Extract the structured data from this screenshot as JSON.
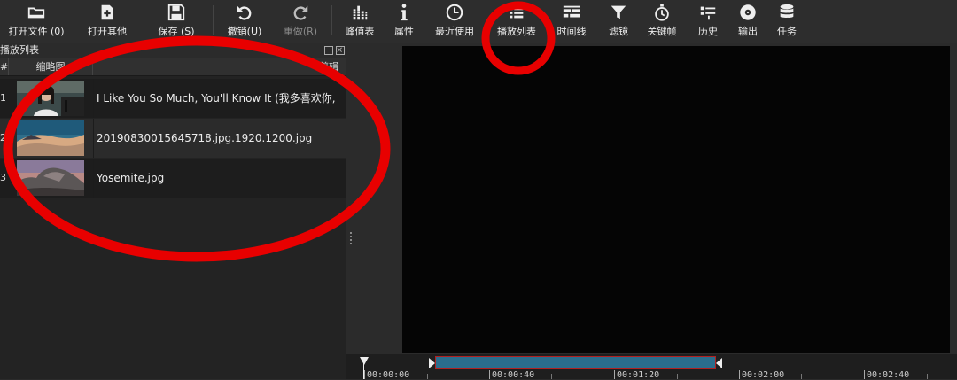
{
  "toolbar": {
    "items": [
      {
        "label": "打开文件 (0)",
        "icon": "folder-open-icon"
      },
      {
        "label": "打开其他",
        "icon": "open-other-icon"
      },
      {
        "label": "保存 (S)",
        "icon": "save-icon"
      },
      {
        "label": "撤销(U)",
        "icon": "undo-icon"
      },
      {
        "label": "重做(R)",
        "icon": "redo-icon",
        "disabled": true
      },
      {
        "label": "峰值表",
        "icon": "peak-meter-icon"
      },
      {
        "label": "属性",
        "icon": "info-icon"
      },
      {
        "label": "最近使用",
        "icon": "clock-icon"
      },
      {
        "label": "播放列表",
        "icon": "playlist-icon"
      },
      {
        "label": "时间线",
        "icon": "timeline-icon"
      },
      {
        "label": "滤镜",
        "icon": "filter-icon"
      },
      {
        "label": "关键帧",
        "icon": "stopwatch-icon"
      },
      {
        "label": "历史",
        "icon": "history-icon"
      },
      {
        "label": "输出",
        "icon": "export-disc-icon"
      },
      {
        "label": "任务",
        "icon": "database-stack-icon"
      }
    ]
  },
  "playlist": {
    "title": "播放列表",
    "headers": {
      "num": "#",
      "thumbnail": "缩略图",
      "clip": "剪辑"
    },
    "rows": [
      {
        "num": "1",
        "name": "I Like You So Much, You'll Know It (我多喜欢你,",
        "thumb": "portrait-thumbnail"
      },
      {
        "num": "2",
        "name": "20190830015645718.jpg.1920.1200.jpg",
        "thumb": "landscape-thumbnail"
      },
      {
        "num": "3",
        "name": "Yosemite.jpg",
        "thumb": "yosemite-thumbnail"
      }
    ]
  },
  "scrubber": {
    "ticks": [
      "00:00:00",
      "00:00:40",
      "00:01:20",
      "00:02:00",
      "00:02:40"
    ]
  },
  "colors": {
    "annotation": "#e80000",
    "range": "#2a6d8c",
    "range_border": "#b02020"
  }
}
